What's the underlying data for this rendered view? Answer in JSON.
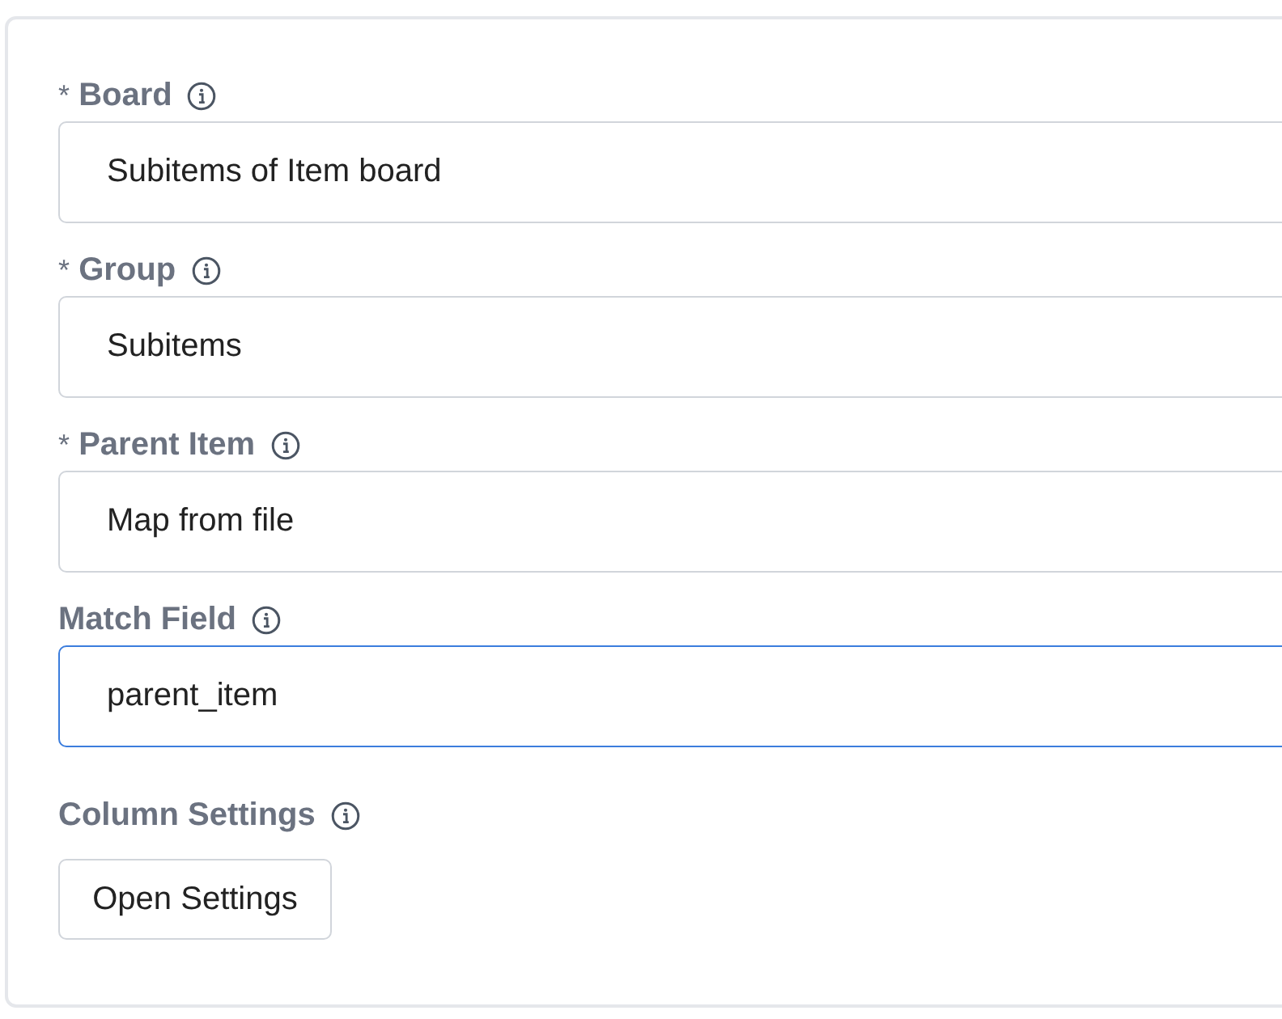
{
  "fields": [
    {
      "required_mark": "*",
      "label": "Board",
      "value": "Subitems of Item board",
      "focused": false
    },
    {
      "required_mark": "*",
      "label": "Group",
      "value": "Subitems",
      "focused": false
    },
    {
      "required_mark": "*",
      "label": "Parent Item",
      "value": "Map from file",
      "focused": false
    },
    {
      "label": "Match Field",
      "value": "parent_item",
      "focused": true
    }
  ],
  "column_settings": {
    "label": "Column Settings",
    "button": "Open Settings"
  }
}
